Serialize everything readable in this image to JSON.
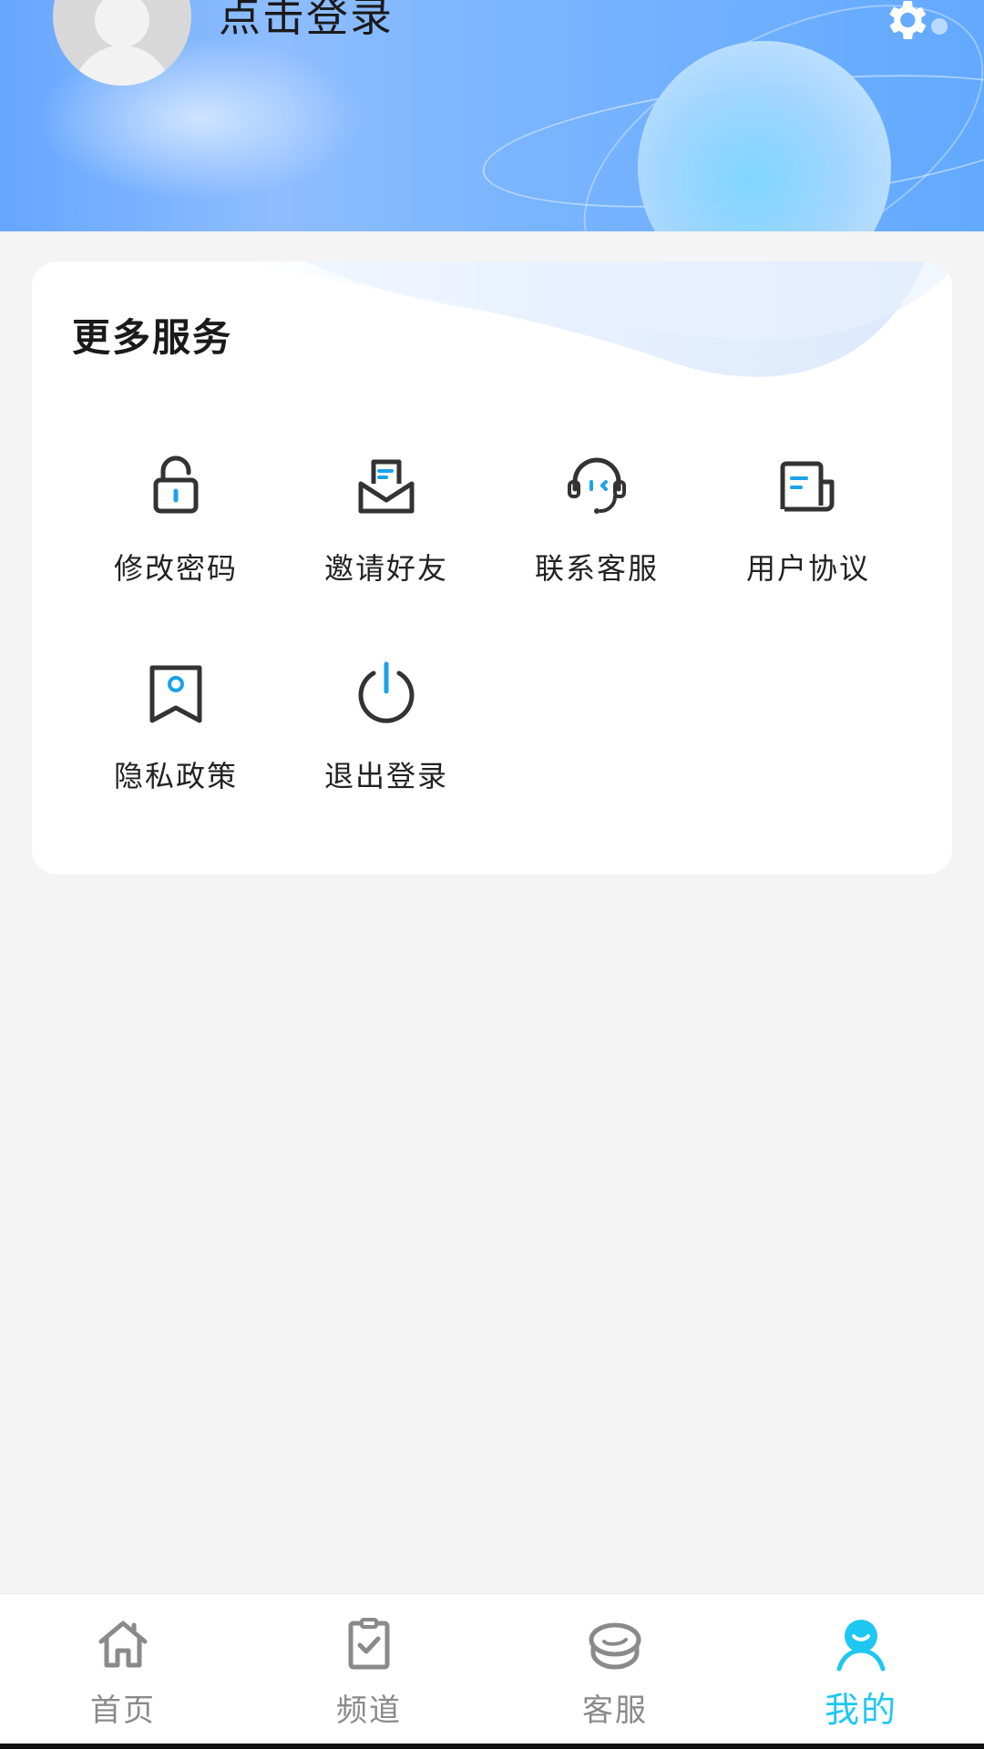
{
  "header": {
    "login_label": "点击登录"
  },
  "services": {
    "title": "更多服务",
    "items": [
      {
        "label": "修改密码",
        "icon": "lock-icon"
      },
      {
        "label": "邀请好友",
        "icon": "envelope-icon"
      },
      {
        "label": "联系客服",
        "icon": "headset-icon"
      },
      {
        "label": "用户协议",
        "icon": "document-icon"
      },
      {
        "label": "隐私政策",
        "icon": "bookmark-icon"
      },
      {
        "label": "退出登录",
        "icon": "power-icon"
      }
    ]
  },
  "nav": {
    "items": [
      {
        "label": "首页",
        "icon": "home-icon",
        "active": false
      },
      {
        "label": "频道",
        "icon": "clipboard-check-icon",
        "active": false
      },
      {
        "label": "客服",
        "icon": "chat-icon",
        "active": false
      },
      {
        "label": "我的",
        "icon": "user-icon",
        "active": true
      }
    ]
  },
  "colors": {
    "accent": "#1ec7f2",
    "icon_stroke": "#333333",
    "icon_highlight": "#1aa3e8",
    "nav_inactive": "#8a8a8a"
  }
}
